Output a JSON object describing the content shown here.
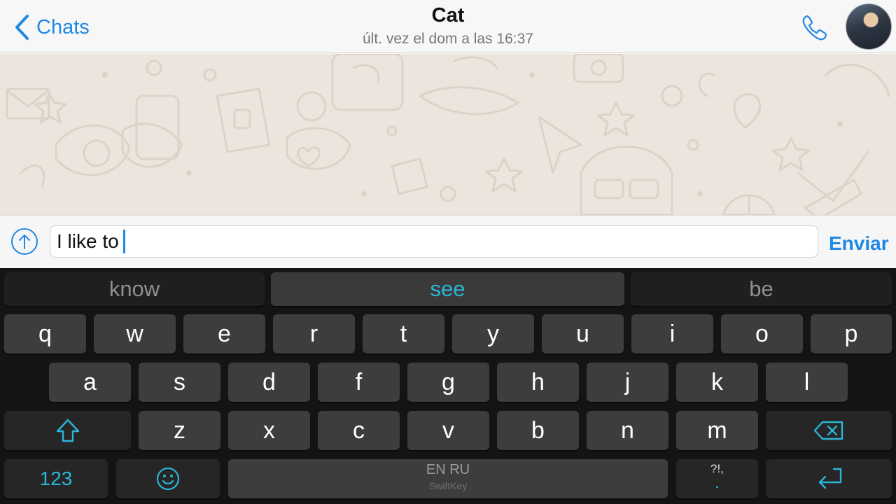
{
  "header": {
    "back_label": "Chats",
    "contact_name": "Cat",
    "last_seen": "últ. vez el dom a las 16:37",
    "call_icon": "phone-icon",
    "avatar": "contact-avatar"
  },
  "composer": {
    "upload_icon": "upload-arrow-icon",
    "text_value": "I like to",
    "send_label": "Enviar"
  },
  "keyboard": {
    "suggestions": [
      "know",
      "see",
      "be"
    ],
    "row1": [
      "q",
      "w",
      "e",
      "r",
      "t",
      "y",
      "u",
      "i",
      "o",
      "p"
    ],
    "row2": [
      "a",
      "s",
      "d",
      "f",
      "g",
      "h",
      "j",
      "k",
      "l"
    ],
    "row3": [
      "z",
      "x",
      "c",
      "v",
      "b",
      "n",
      "m"
    ],
    "numbers_label": "123",
    "space_languages": "EN RU",
    "space_brand": "SwiftKey",
    "punct_label": "?!,",
    "punct_dot": ".",
    "accent_color": "#2bb5d6"
  },
  "colors": {
    "ios_blue": "#1e88e5",
    "chat_background": "#ece5dd",
    "keyboard_background": "#141414"
  }
}
